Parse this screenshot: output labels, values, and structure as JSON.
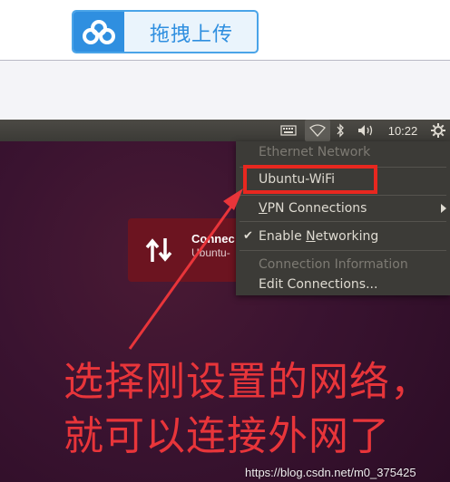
{
  "upload_button": {
    "label": "拖拽上传",
    "icon": "cloud-connect-icon"
  },
  "panel": {
    "clock": "10:22",
    "icons": [
      "keyboard-icon",
      "wifi-icon",
      "bluetooth-icon",
      "volume-icon",
      "gear-icon"
    ]
  },
  "notification": {
    "icon": "up-down-arrows-icon",
    "title": "Connec",
    "subtitle": "Ubuntu-"
  },
  "network_menu": {
    "items": [
      {
        "label": "Ethernet Network",
        "enabled": false
      },
      {
        "label": "Ubuntu-WiFi",
        "enabled": true,
        "highlighted": true
      },
      {
        "label": "VPN Connections",
        "enabled": true,
        "submenu": true
      },
      {
        "label": "Enable Networking",
        "enabled": true,
        "checked": true
      },
      {
        "label": "Connection Information",
        "enabled": false
      },
      {
        "label": "Edit Connections...",
        "enabled": true
      }
    ]
  },
  "annotation": {
    "text": "选择刚设置的网络，就可以连接外网了",
    "color": "#e8353a"
  },
  "watermark": "https://blog.csdn.net/m0_375425"
}
